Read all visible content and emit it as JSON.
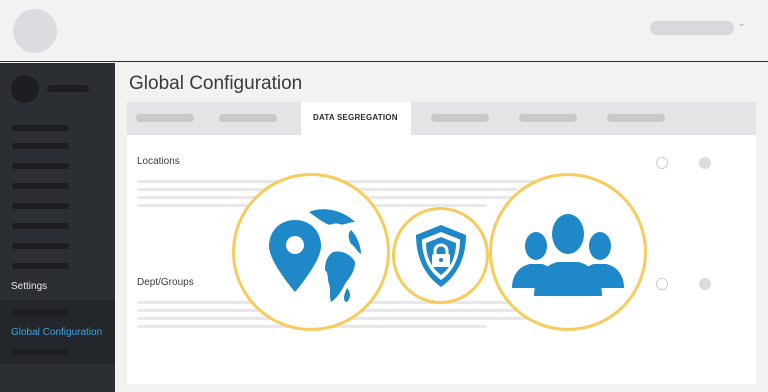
{
  "page": {
    "title": "Global Configuration"
  },
  "sidebar": {
    "settings_label": "Settings",
    "active_item_label": "Global Configuration"
  },
  "tabs": {
    "active_label": "DATA SEGREGATION"
  },
  "sections": [
    {
      "label": "Locations"
    },
    {
      "label": "Dept/Groups"
    }
  ],
  "feature_icons": [
    "location-globe-icon",
    "security-shield-lock-icon",
    "user-group-icon"
  ],
  "colors": {
    "accent_blue": "#3aa7e0",
    "icon_blue": "#1e88c8",
    "circle_border": "#f7cc5d",
    "sidebar_bg": "#2b2e33"
  }
}
